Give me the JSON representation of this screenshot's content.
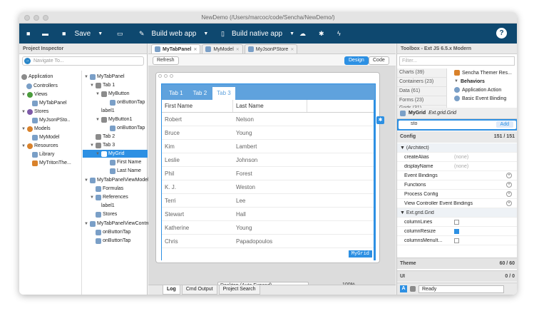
{
  "window": {
    "title": "NewDemo (/Users/marcoc/code/Sencha/NewDemo/)"
  },
  "toolbar": {
    "save": "Save",
    "web": "Build web app",
    "native": "Build native app",
    "help": "?"
  },
  "inspector": {
    "title": "Project Inspector",
    "navigate_placeholder": "Navigate To...",
    "left_nodes": [
      "Application",
      "Controllers",
      "Views",
      "MyTabPanel",
      "Stores",
      "MyJsonPSto..",
      "Models",
      "MyModel",
      "Resources",
      "Library",
      "MyTritonThe..."
    ],
    "tree": [
      "MyTabPanel",
      "Tab 1",
      "MyButton",
      "onButtonTap",
      "label1",
      "MyButton1",
      "onButtonTap",
      "Tab 2",
      "Tab 3",
      "MyGrid",
      "First Name",
      "Last Name",
      "MyTabPanelViewModel",
      "Formulas",
      "References",
      "label1",
      "Stores",
      "MyTabPanelViewContro",
      "onButtonTap",
      "onButtonTap"
    ]
  },
  "editor": {
    "tabs": [
      "MyTabPanel",
      "MyModel",
      "MyJsonPStore"
    ],
    "refresh": "Refresh",
    "design": "Design",
    "code": "Code",
    "panel_tabs": [
      "Tab 1",
      "Tab 2",
      "Tab 3"
    ],
    "columns": [
      "First Name",
      "Last Name"
    ],
    "rows": [
      [
        "Robert",
        "Nelson"
      ],
      [
        "Bruce",
        "Young"
      ],
      [
        "Kim",
        "Lambert"
      ],
      [
        "Leslie",
        "Johnson"
      ],
      [
        "Phil",
        "Forest"
      ],
      [
        "K. J.",
        "Weston"
      ],
      [
        "Terri",
        "Lee"
      ],
      [
        "Stewart",
        "Hall"
      ],
      [
        "Katherine",
        "Young"
      ],
      [
        "Chris",
        "Papadopoulos"
      ]
    ],
    "grid_label": "MyGrid",
    "device": "Desktop (Auto Expand)",
    "zoom": "100%",
    "log_tabs": [
      "Log",
      "Cmd Output",
      "Project Search"
    ]
  },
  "toolbox": {
    "title": "Toolbox - Ext JS 6.5.x Modern",
    "filter_placeholder": "Filter...",
    "categories": [
      "Charts (39)",
      "Containers (23)",
      "Data (61)",
      "Forms (23)",
      "Grids (31)"
    ],
    "components": [
      "Sencha Themer Res...",
      "Behaviors",
      "Application Action",
      "Basic Event Binding"
    ]
  },
  "config": {
    "component": "MyGrid",
    "component_type": "Ext.grid.Grid",
    "search_value": "sto",
    "add": "Add",
    "title": "Config",
    "count": "151 / 151",
    "rows": [
      {
        "k": "(Architect)",
        "type": "section"
      },
      {
        "k": "createAlias",
        "v": "(none)"
      },
      {
        "k": "displayName",
        "v": "(none)"
      },
      {
        "k": "Event Bindings",
        "type": "plus"
      },
      {
        "k": "Functions",
        "type": "plus"
      },
      {
        "k": "Process Config",
        "type": "plus"
      },
      {
        "k": "View Controller Event Bindings",
        "type": "plus"
      },
      {
        "k": "Ext.grid.Grid",
        "type": "section"
      },
      {
        "k": "columnLines",
        "type": "check"
      },
      {
        "k": "columnResize",
        "type": "checked"
      },
      {
        "k": "columnsMenuIt...",
        "type": "check"
      }
    ],
    "theme": "Theme",
    "theme_count": "60 / 60",
    "ui": "UI",
    "ui_count": "0 / 0",
    "status": "Ready"
  }
}
